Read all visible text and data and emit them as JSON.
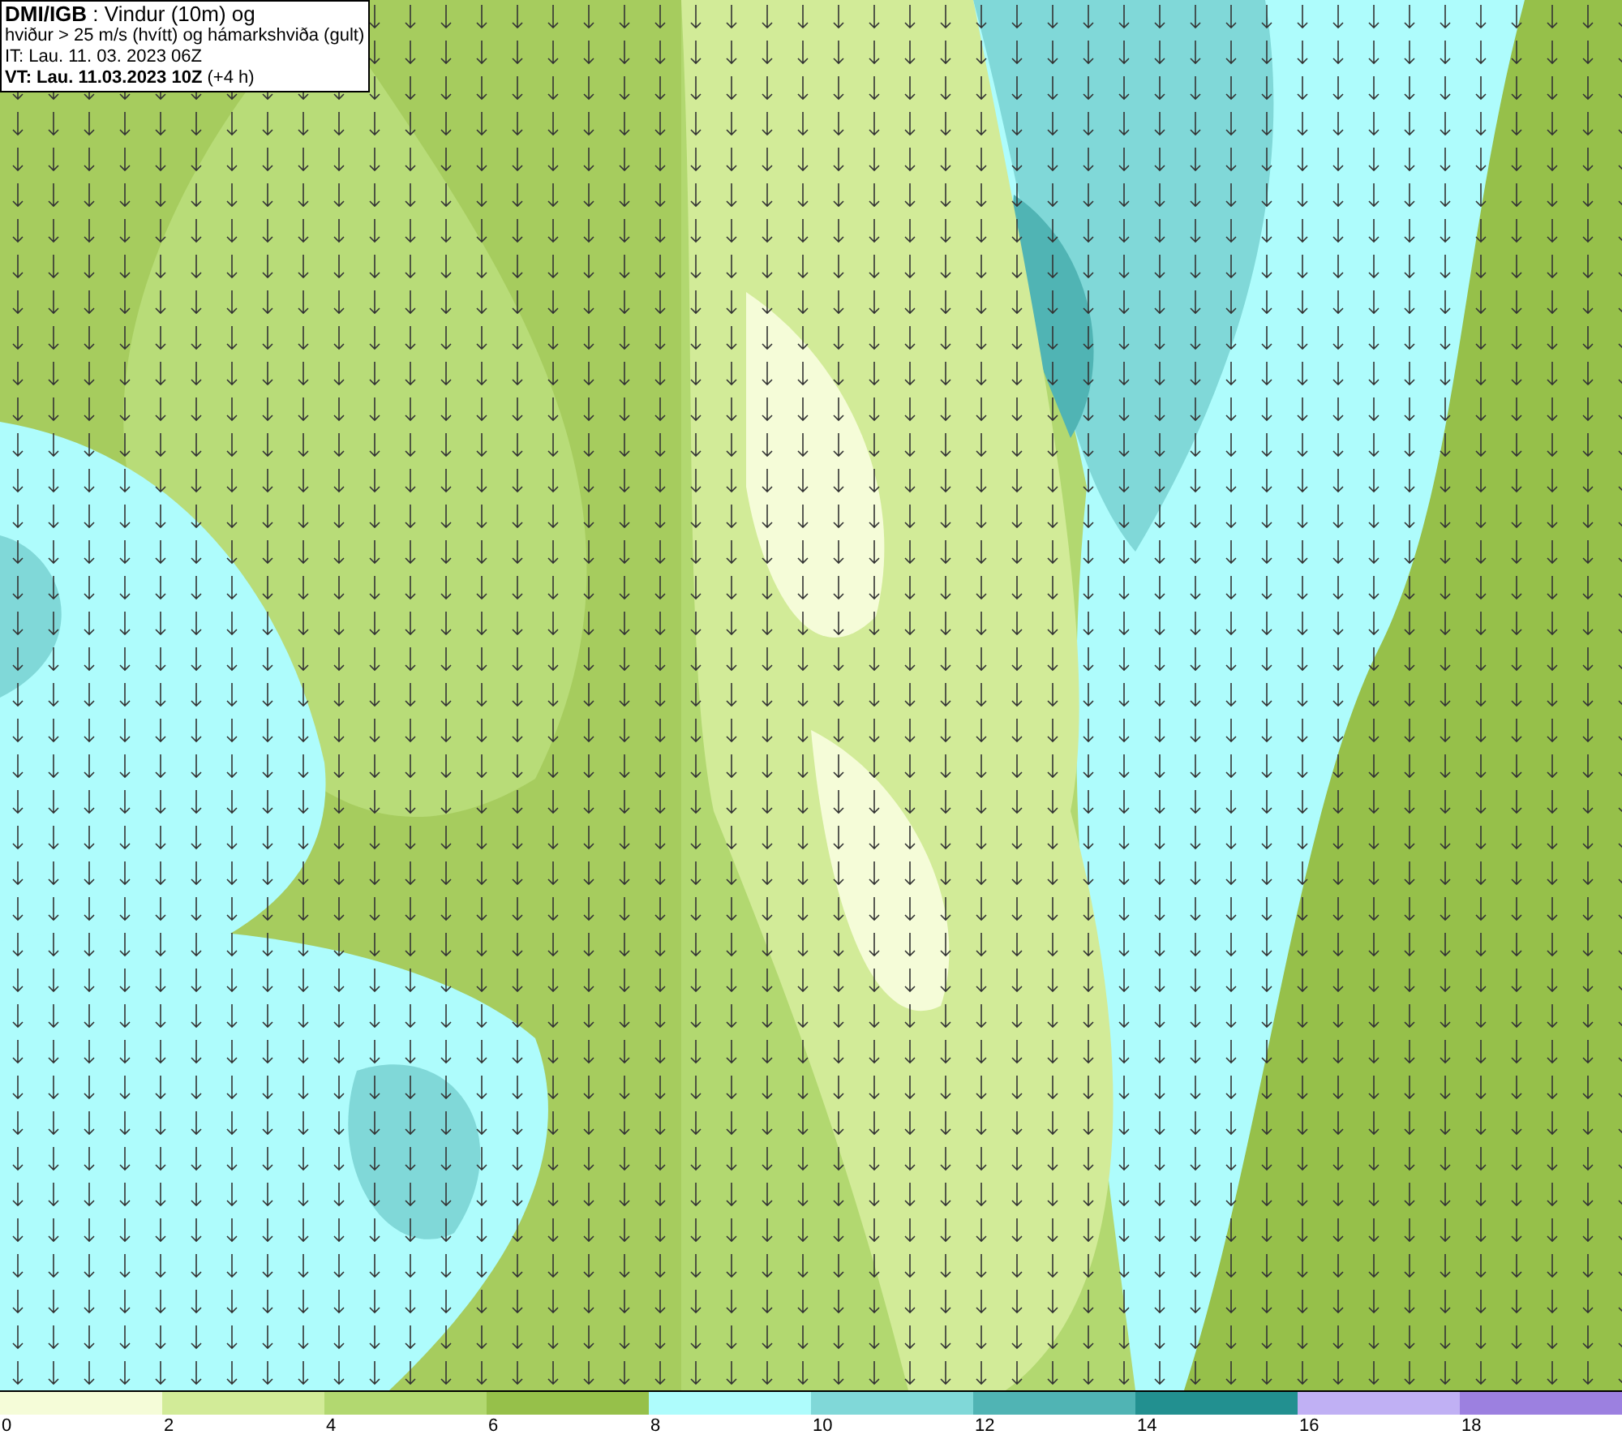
{
  "info_box": {
    "lines": [
      "**DMI/IGB** : Vindur (10m) og",
      "hviður > 25 m/s (hvítt) og hámarkshviða (gult)",
      "IT: Lau. 11. 03. 2023 06Z",
      "**VT: Lau. 11.03.2023 10Z** (+4 h)"
    ]
  },
  "legend": [
    {
      "label": "0",
      "color": "#f5fcd8"
    },
    {
      "label": "2",
      "color": "#d2eb98"
    },
    {
      "label": "4",
      "color": "#b2d870"
    },
    {
      "label": "6",
      "color": "#96c04a"
    },
    {
      "label": "8",
      "color": "#aefcfc"
    },
    {
      "label": "10",
      "color": "#80d8d8"
    },
    {
      "label": "12",
      "color": "#50b4b4"
    },
    {
      "label": "14",
      "color": "#229090"
    },
    {
      "label": "16",
      "color": "#c0b0f4"
    },
    {
      "label": "18",
      "color": "#9c80e0"
    }
  ]
}
